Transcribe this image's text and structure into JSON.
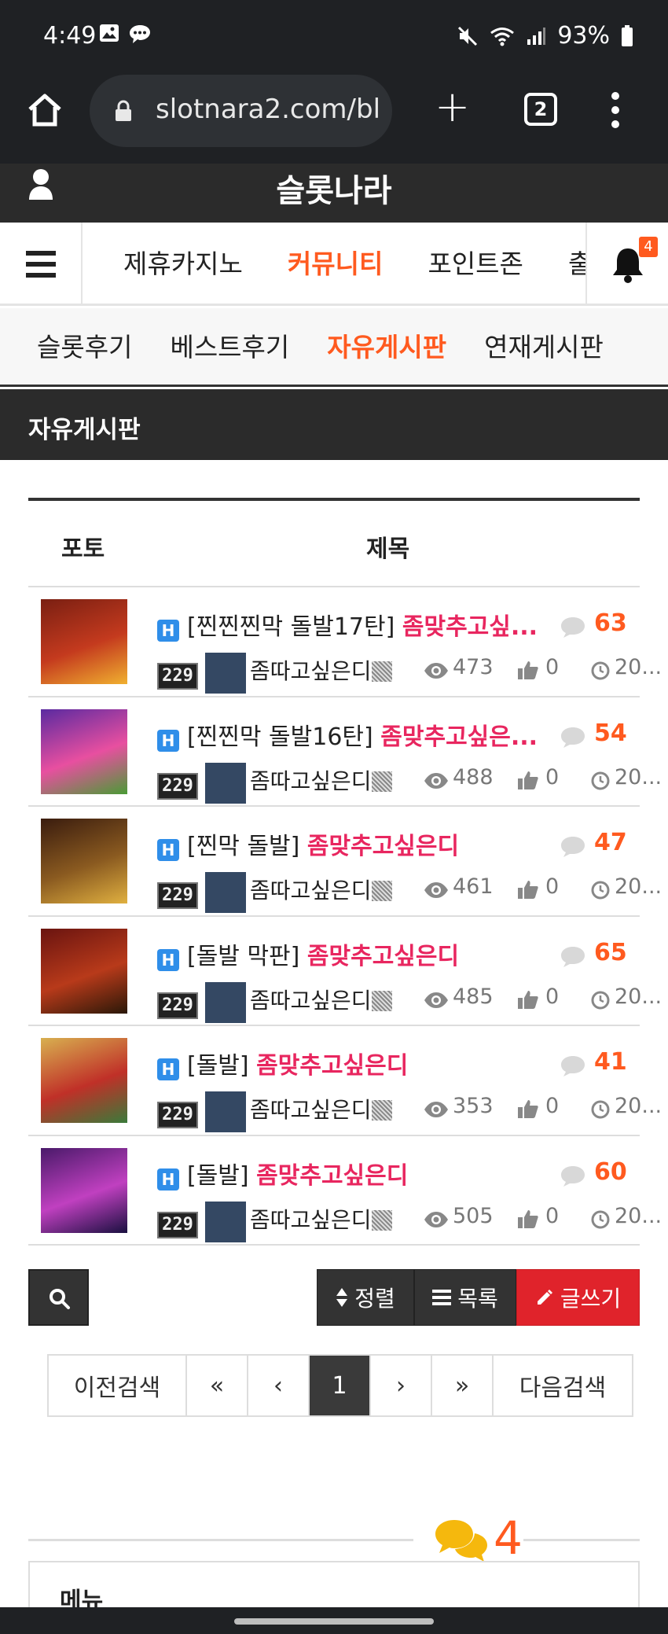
{
  "status": {
    "time": "4:49",
    "battery": "93%"
  },
  "browser": {
    "url": "slotnara2.com/bl",
    "tab_count": "2"
  },
  "site": {
    "title": "슬롯나라"
  },
  "main_nav": {
    "items": [
      "제휴카지노",
      "커뮤니티",
      "포인트존",
      "출"
    ],
    "active": "커뮤니티",
    "notification_count": "4"
  },
  "sub_nav": {
    "items": [
      "슬롯후기",
      "베스트후기",
      "자유게시판",
      "연재게시판"
    ],
    "active": "자유게시판"
  },
  "section": {
    "title": "자유게시판"
  },
  "table": {
    "headers": {
      "photo": "포토",
      "title": "제목"
    },
    "rows": [
      {
        "prefix": "[찐찐찐막 돌발17탄]",
        "tag": "좀맞추고싶...",
        "comments": "63",
        "level": "229",
        "author": "좀따고싶은디",
        "views": "473",
        "likes": "0",
        "date": "20..."
      },
      {
        "prefix": "[찐찐막 돌발16탄]",
        "tag": "좀맞추고싶은...",
        "comments": "54",
        "level": "229",
        "author": "좀따고싶은디",
        "views": "488",
        "likes": "0",
        "date": "20..."
      },
      {
        "prefix": "[찐막 돌발]",
        "tag": "좀맞추고싶은디",
        "comments": "47",
        "level": "229",
        "author": "좀따고싶은디",
        "views": "461",
        "likes": "0",
        "date": "20..."
      },
      {
        "prefix": "[돌발 막판]",
        "tag": "좀맞추고싶은디",
        "comments": "65",
        "level": "229",
        "author": "좀따고싶은디",
        "views": "485",
        "likes": "0",
        "date": "20..."
      },
      {
        "prefix": "[돌발]",
        "tag": "좀맞추고싶은디",
        "comments": "41",
        "level": "229",
        "author": "좀따고싶은디",
        "views": "353",
        "likes": "0",
        "date": "20..."
      },
      {
        "prefix": "[돌발]",
        "tag": "좀맞추고싶은디",
        "comments": "60",
        "level": "229",
        "author": "좀따고싶은디",
        "views": "505",
        "likes": "0",
        "date": "20..."
      }
    ]
  },
  "toolbar": {
    "sort": "정렬",
    "list": "목록",
    "write": "글쓰기"
  },
  "pager": {
    "prev_search": "이전검색",
    "first": "«",
    "prev": "‹",
    "current": "1",
    "next": "›",
    "last": "»",
    "next_search": "다음검색"
  },
  "chat": {
    "count": "4"
  },
  "menu": {
    "title": "메뉴"
  },
  "colors": {
    "accent": "#ff5a1f",
    "author_tag": "#e8265f",
    "write_button": "#e0232b",
    "dark_bar": "#2b2b2b"
  }
}
